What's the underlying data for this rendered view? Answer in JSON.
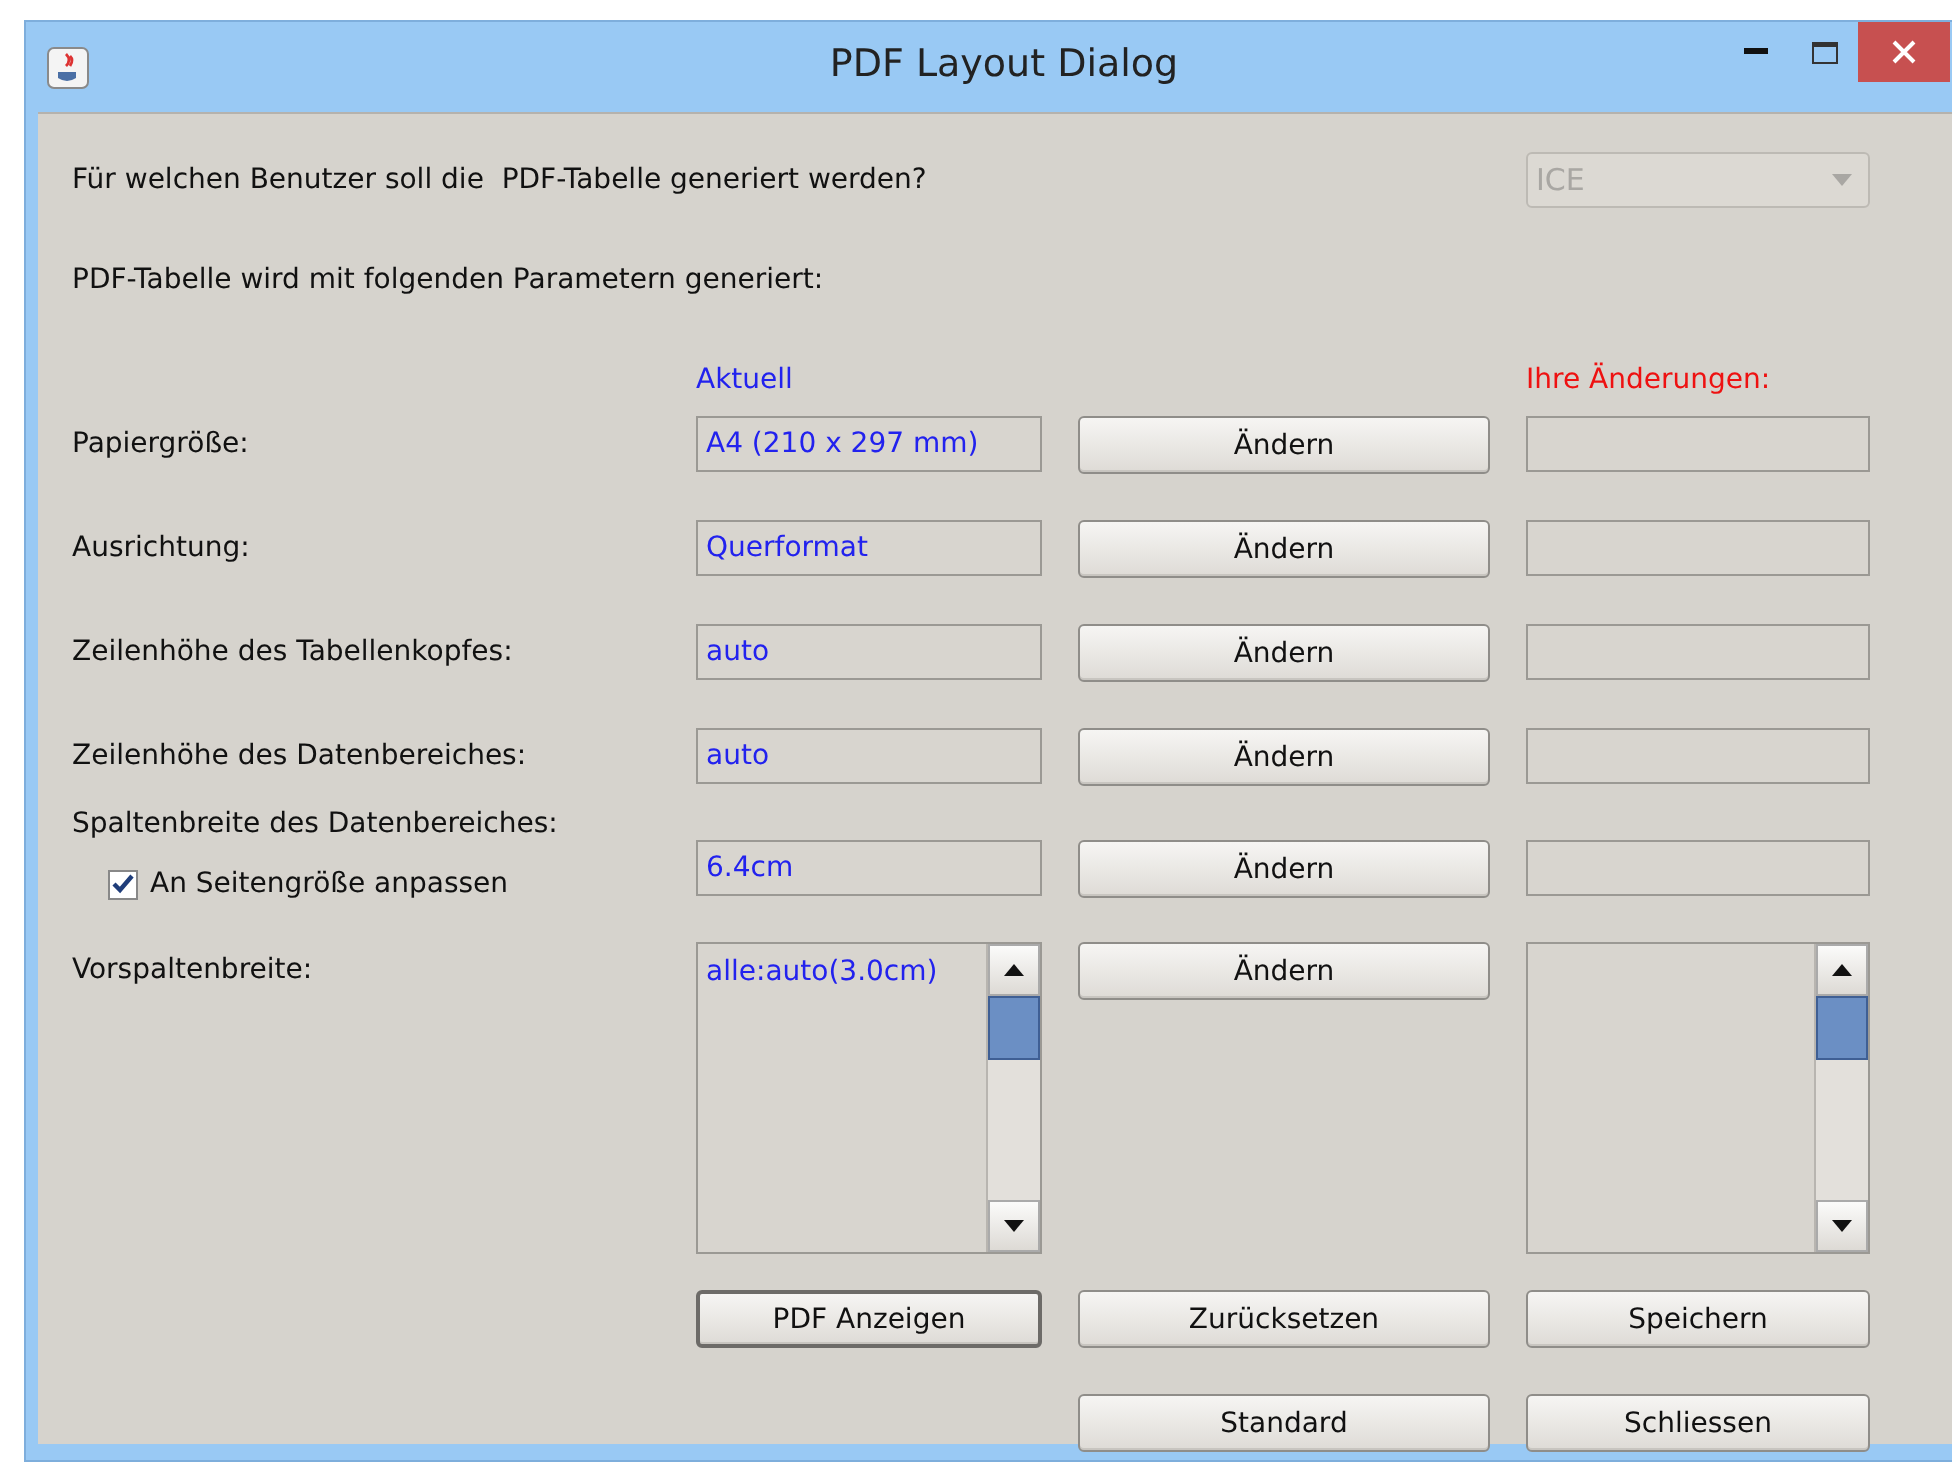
{
  "window": {
    "title": "PDF Layout Dialog"
  },
  "question": {
    "label": "Für welchen Benutzer soll die  PDF-Tabelle generiert werden?",
    "user_combo": {
      "value": "ICE",
      "disabled": true
    }
  },
  "intro": "PDF-Tabelle wird mit folgenden Parametern generiert:",
  "headers": {
    "current": "Aktuell",
    "changes": "Ihre Änderungen:"
  },
  "rows": [
    {
      "kind": "field",
      "label": "Papiergröße:",
      "current": "A4 (210 x 297 mm)",
      "button": "Ändern"
    },
    {
      "kind": "field",
      "label": "Ausrichtung:",
      "current": "Querformat",
      "button": "Ändern"
    },
    {
      "kind": "field",
      "label": "Zeilenhöhe des Tabellenkopfes:",
      "current": "auto",
      "button": "Ändern"
    },
    {
      "kind": "field",
      "label": "Zeilenhöhe des Datenbereiches:",
      "current": "auto",
      "button": "Ändern"
    },
    {
      "kind": "field",
      "label": "Spaltenbreite des Datenbereiches:",
      "current": "6.4cm",
      "button": "Ändern",
      "checkbox": {
        "label": "An Seitengröße anpassen",
        "checked": true
      }
    },
    {
      "kind": "list",
      "label": "Vorspaltenbreite:",
      "current": "alle:auto(3.0cm)",
      "button": "Ändern"
    }
  ],
  "button_rows": [
    [
      {
        "label": "PDF Anzeigen",
        "focused": true
      },
      {
        "label": "Zurücksetzen",
        "focused": false
      },
      {
        "label": "Speichern",
        "focused": false
      }
    ],
    [
      {
        "label": "Standard",
        "focused": false
      },
      {
        "label": "Schliessen",
        "focused": false
      }
    ]
  ]
}
